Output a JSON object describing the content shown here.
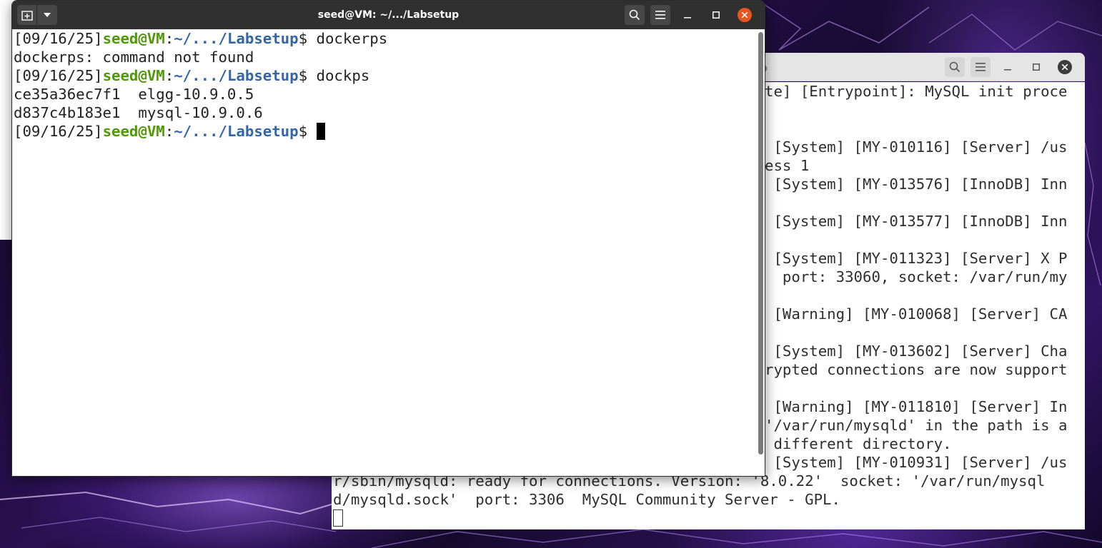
{
  "colors": {
    "prompt_user": "#4e9a06",
    "prompt_path": "#3465a4",
    "close_accent": "#e95420",
    "titlebar_dark": "#303030"
  },
  "front_window": {
    "title": "seed@VM: ~/.../Labsetup",
    "icons": [
      "new-tab-icon",
      "chevron-down-icon",
      "search-icon",
      "hamburger-menu-icon",
      "minimize-icon",
      "maximize-icon",
      "close-icon"
    ],
    "prompt": {
      "date": "[09/16/25]",
      "user": "seed@VM",
      "colon": ":",
      "path": "~/.../Labsetup",
      "dollar": "$ "
    },
    "lines": {
      "cmd1": "dockerps",
      "out1": "dockerps: command not found",
      "cmd2": "dockps",
      "out2": "ce35a36ec7f1  elgg-10.9.0.5",
      "out3": "d837c4b183e1  mysql-10.9.0.6",
      "cmd3": ""
    }
  },
  "back_window": {
    "title_fragment": "p",
    "icons": [
      "search-icon",
      "hamburger-menu-icon",
      "minimize-icon",
      "maximize-icon",
      "close-icon"
    ],
    "lines": [
      "te] [Entrypoint]: MySQL init proce",
      "",
      "",
      " [System] [MY-010116] [Server] /us",
      "ess 1",
      " [System] [MY-013576] [InnoDB] Inn",
      "",
      " [System] [MY-013577] [InnoDB] Inn",
      "",
      " [System] [MY-011323] [Server] X P",
      "  port: 33060, socket: /var/run/my",
      "",
      " [Warning] [MY-010068] [Server] CA",
      "",
      " [System] [MY-013602] [Server] Cha",
      "rypted connections are now support",
      "",
      " [Warning] [MY-011810] [Server] In",
      "'/var/run/mysqld' in the path is a",
      " different directory.",
      " [System] [MY-010931] [Server] /us",
      "r/sbin/mysqld: ready for connections. Version: '8.0.22'  socket: '/var/run/mysql",
      "d/mysqld.sock'  port: 3306  MySQL Community Server - GPL.",
      ""
    ]
  }
}
